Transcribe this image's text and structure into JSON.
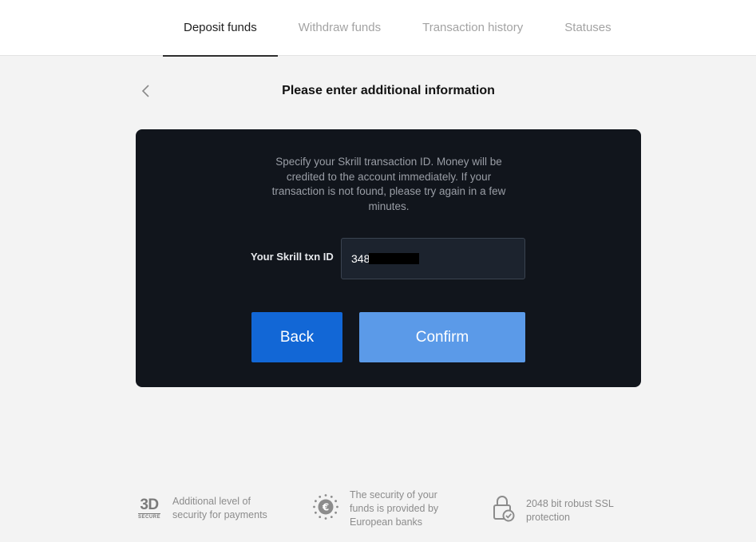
{
  "tabs": [
    {
      "label": "Deposit funds",
      "active": true
    },
    {
      "label": "Withdraw funds",
      "active": false
    },
    {
      "label": "Transaction history",
      "active": false
    },
    {
      "label": "Statuses",
      "active": false
    }
  ],
  "page": {
    "title": "Please enter additional information",
    "back_icon": "chevron-left-icon"
  },
  "form": {
    "info": "Specify your Skrill transaction ID. Money will be credited to the account immediately. If your transaction is not found, please try again in a few minutes.",
    "label": "Your Skrill txn ID",
    "value": "348",
    "back_label": "Back",
    "confirm_label": "Confirm"
  },
  "footer": {
    "features": [
      {
        "icon": "3d-secure-icon",
        "text": "Additional level of security for payments",
        "logo_big": "3D",
        "logo_small": "SECURE"
      },
      {
        "icon": "euro-shield-icon",
        "text": "The security of your funds is provided by European banks"
      },
      {
        "icon": "lock-check-icon",
        "text": "2048 bit robust SSL protection"
      }
    ]
  },
  "colors": {
    "card_bg": "#11151c",
    "back_button": "#1267d6",
    "confirm_button": "#5b9ae8",
    "page_bg": "#f3f3f3"
  }
}
